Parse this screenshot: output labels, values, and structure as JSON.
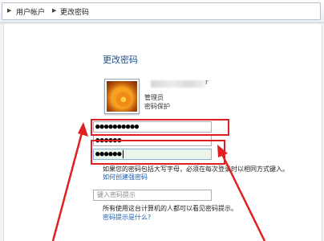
{
  "breadcrumb": {
    "items": [
      "用户帐户",
      "更改密码"
    ]
  },
  "page": {
    "title": "更改密码"
  },
  "account": {
    "name_visible_suffix": "r",
    "role": "管理员",
    "status": "密码保护"
  },
  "form": {
    "current_password": "●●●●●●●●●●",
    "new_password": "●●●●●●",
    "confirm_password": "●●●●●●",
    "password_hint_placeholder": "键入密码提示"
  },
  "notes": {
    "caps_note": "如果您的密码包括大写字母，必须在每次登录时以相同方式键入。",
    "strong_password_link": "如何创建强密码",
    "hint_visibility_note": "所有使用这台计算机的人都可以看见密码提示。",
    "hint_link": "密码提示是什么?"
  },
  "colors": {
    "annotation": "#e02020",
    "title": "#1e4f91",
    "link": "#1a5fb4"
  }
}
